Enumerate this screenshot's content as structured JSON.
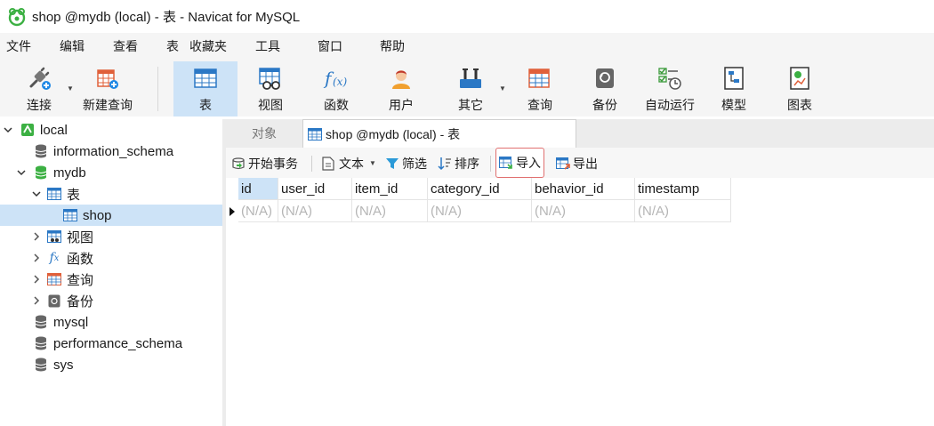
{
  "window": {
    "title": "shop @mydb (local) - 表 - Navicat for MySQL"
  },
  "menu": [
    "文件",
    "编辑",
    "查看",
    "表",
    "收藏夹",
    "工具",
    "窗口",
    "帮助"
  ],
  "toolbar": {
    "connect": "连接",
    "new_query": "新建查询",
    "table": "表",
    "view": "视图",
    "function": "函数",
    "user": "用户",
    "other": "其它",
    "query": "查询",
    "backup": "备份",
    "automation": "自动运行",
    "model": "模型",
    "chart": "图表"
  },
  "tree": {
    "connection": "local",
    "db_information_schema": "information_schema",
    "db_mydb": "mydb",
    "node_tables": "表",
    "table_shop": "shop",
    "node_views": "视图",
    "node_functions": "函数",
    "node_queries": "查询",
    "node_backups": "备份",
    "db_mysql": "mysql",
    "db_performance_schema": "performance_schema",
    "db_sys": "sys"
  },
  "tabs": {
    "objects": "对象",
    "active": "shop @mydb (local) - 表"
  },
  "subtoolbar": {
    "begin_transaction": "开始事务",
    "text": "文本",
    "filter": "筛选",
    "sort": "排序",
    "import": "导入",
    "export": "导出"
  },
  "grid": {
    "columns": [
      "id",
      "user_id",
      "item_id",
      "category_id",
      "behavior_id",
      "timestamp"
    ],
    "row": [
      "(N/A)",
      "(N/A)",
      "(N/A)",
      "(N/A)",
      "(N/A)",
      "(N/A)"
    ]
  },
  "colors": {
    "selection": "#cde3f7",
    "highlight_border": "#e07070",
    "navicat_green": "#3cb043"
  }
}
